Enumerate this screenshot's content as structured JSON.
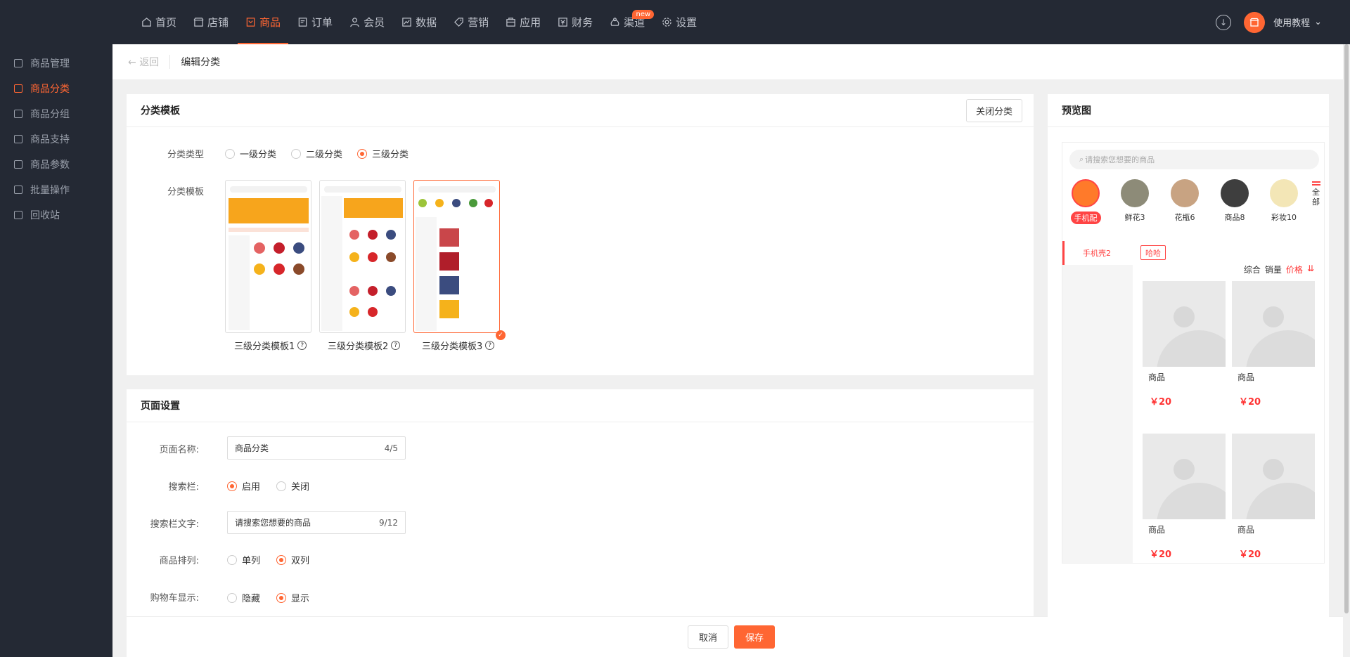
{
  "nav": {
    "items": [
      {
        "label": "首页",
        "icon": "home-icon"
      },
      {
        "label": "店铺",
        "icon": "store-icon"
      },
      {
        "label": "商品",
        "icon": "goods-icon",
        "active": true
      },
      {
        "label": "订单",
        "icon": "order-icon"
      },
      {
        "label": "会员",
        "icon": "member-icon"
      },
      {
        "label": "数据",
        "icon": "chart-icon"
      },
      {
        "label": "营销",
        "icon": "tag-icon"
      },
      {
        "label": "应用",
        "icon": "app-icon"
      },
      {
        "label": "财务",
        "icon": "finance-icon"
      },
      {
        "label": "渠道",
        "icon": "channel-icon",
        "badge": "new"
      },
      {
        "label": "设置",
        "icon": "gear-icon"
      }
    ],
    "tutorial": "使用教程"
  },
  "sidebar": {
    "items": [
      {
        "label": "商品管理"
      },
      {
        "label": "商品分类",
        "active": true
      },
      {
        "label": "商品分组"
      },
      {
        "label": "商品支持"
      },
      {
        "label": "商品参数"
      },
      {
        "label": "批量操作"
      },
      {
        "label": "回收站"
      }
    ]
  },
  "breadcrumb": {
    "back": "返回",
    "title": "编辑分类"
  },
  "template_card": {
    "title": "分类模板",
    "close_btn": "关闭分类",
    "type_label": "分类类型",
    "type_options": [
      "一级分类",
      "二级分类",
      "三级分类"
    ],
    "type_selected": "三级分类",
    "template_label": "分类模板",
    "templates": [
      "三级分类模板1",
      "三级分类模板2",
      "三级分类模板3"
    ]
  },
  "page_card": {
    "title": "页面设置",
    "name_label": "页面名称:",
    "name_value": "商品分类",
    "name_count": "4/5",
    "search_label": "搜索栏:",
    "search_options": [
      "启用",
      "关闭"
    ],
    "search_text_label": "搜索栏文字:",
    "search_text_value": "请搜索您想要的商品",
    "search_text_count": "9/12",
    "sort_label": "商品排列:",
    "sort_options": [
      "单列",
      "双列"
    ],
    "cart_label": "购物车显示:",
    "cart_options": [
      "隐藏",
      "显示"
    ]
  },
  "footer": {
    "cancel": "取消",
    "save": "保存"
  },
  "preview": {
    "title": "预览图",
    "search_placeholder": "请搜索您想要的商品",
    "categories": [
      "手机配",
      "鲜花3",
      "花瓶6",
      "商品8",
      "彩妆10"
    ],
    "more_label": "全部",
    "side_category": "手机壳2",
    "sub_tag": "哈哈",
    "sort_tabs": [
      "综合",
      "销量",
      "价格"
    ],
    "products": [
      {
        "name": "商品",
        "price": "￥20"
      },
      {
        "name": "商品",
        "price": "￥20"
      },
      {
        "name": "商品",
        "price": "￥20"
      },
      {
        "name": "商品",
        "price": "￥20"
      }
    ]
  },
  "colors": {
    "accent": "#ff6633",
    "nav_bg": "#242934",
    "price": "#ff3333"
  }
}
